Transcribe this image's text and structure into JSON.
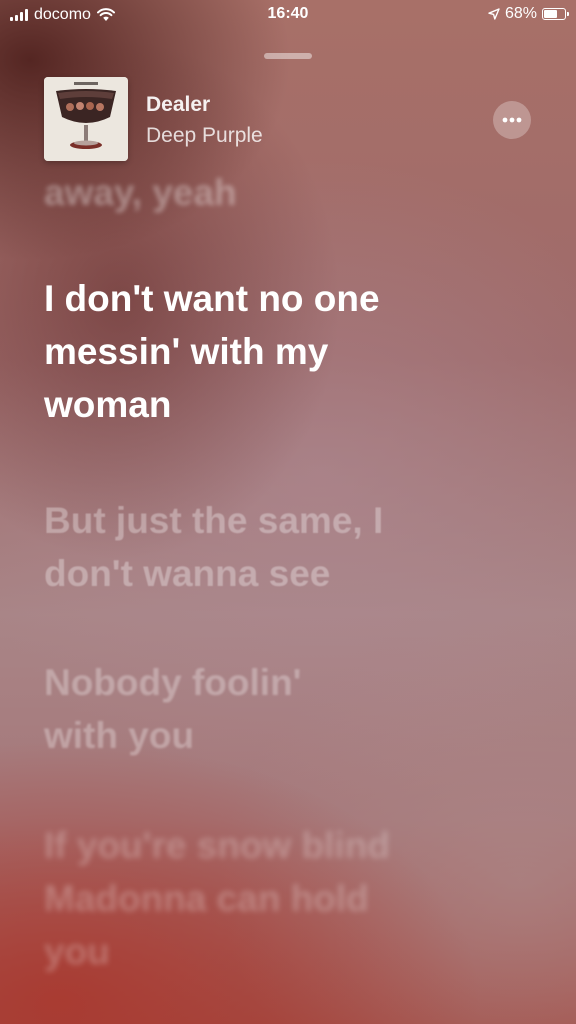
{
  "status_bar": {
    "carrier": "docomo",
    "time": "16:40",
    "battery_percent_text": "68%",
    "battery_level": 0.68
  },
  "now_playing": {
    "title": "Dealer",
    "artist": "Deep Purple",
    "album_art_icon": "album-cover-goblet"
  },
  "more_button": {
    "icon": "ellipsis-icon"
  },
  "lyrics": {
    "previous": [
      "away, yeah"
    ],
    "current": [
      "I don't want no one",
      "messin' with my",
      "woman"
    ],
    "upcoming": [
      [
        "But just the same, I",
        "don't wanna see"
      ],
      [
        "Nobody foolin'",
        "with you"
      ],
      [
        "If you're snow blind",
        "Madonna can hold",
        "you"
      ]
    ]
  },
  "colors": {
    "text_primary": "#ffffff",
    "background_top": "#a87068",
    "background_bottom": "#a34f48"
  }
}
